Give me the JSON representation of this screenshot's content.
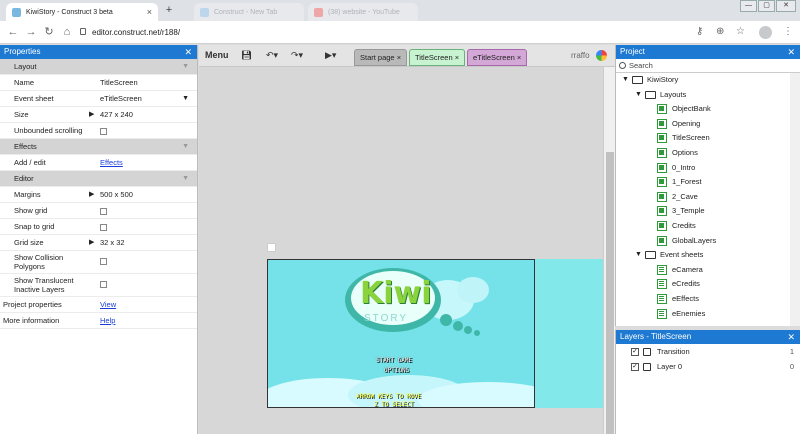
{
  "browser": {
    "tabs": [
      {
        "title": "KiwiStory - Construct 3 beta",
        "active": true
      },
      {
        "title": "Construct - New Tab",
        "active": false
      },
      {
        "title": "(38) website - YouTube",
        "active": false
      }
    ],
    "url": "editor.construct.net/r188/",
    "new_tab": "+",
    "win_min": "—",
    "win_max": "▢",
    "win_close": "✕"
  },
  "properties": {
    "title": "Properties",
    "close": "✕",
    "layout_section": "Layout",
    "rows_layout": [
      {
        "label": "Name",
        "value": "TitleScreen"
      },
      {
        "label": "Event sheet",
        "value": "eTitleScreen"
      },
      {
        "label": "Size",
        "value": "427 x 240"
      },
      {
        "label": "Unbounded scrolling",
        "value": ""
      }
    ],
    "effects_section": "Effects",
    "add_edit": {
      "label": "Add / edit",
      "value": "Effects"
    },
    "editor_section": "Editor",
    "rows_editor": [
      {
        "label": "Margins",
        "value": "500 x 500"
      },
      {
        "label": "Show grid",
        "value": ""
      },
      {
        "label": "Snap to grid",
        "value": ""
      },
      {
        "label": "Grid size",
        "value": "32 x 32"
      },
      {
        "label": "Show Collision Polygons",
        "value": ""
      },
      {
        "label": "Show Translucent Inactive Layers",
        "value": ""
      }
    ],
    "project_properties": {
      "label": "Project properties",
      "value": "View"
    },
    "more_info": {
      "label": "More information",
      "value": "Help"
    }
  },
  "toolbar": {
    "menu": "Menu",
    "tabs": [
      {
        "label": "Start page",
        "active": false
      },
      {
        "label": "TitleScreen",
        "active": true
      },
      {
        "label": "eTitleScreen",
        "active": false
      }
    ],
    "user": "rraffo"
  },
  "canvas": {
    "logo_main": "Kiwi",
    "logo_sub": "STORY",
    "menu_items": [
      "START GAME",
      "OPTIONS"
    ],
    "hint1": "ARROW KEYS TO MOVE",
    "hint2": "Z TO SELECT"
  },
  "project": {
    "title": "Project",
    "close": "✕",
    "search": "Search",
    "root": "KiwiStory",
    "layouts_folder": "Layouts",
    "layouts": [
      "ObjectBank",
      "Opening",
      "TitleScreen",
      "Options",
      "0_Intro",
      "1_Forest",
      "2_Cave",
      "3_Temple",
      "Credits",
      "GlobalLayers"
    ],
    "events_folder": "Event sheets",
    "event_sheets": [
      "eCamera",
      "eCredits",
      "eEffects",
      "eEnemies"
    ]
  },
  "layers": {
    "title": "Layers - TitleScreen",
    "close": "✕",
    "rows": [
      {
        "name": "Transition",
        "index": "1"
      },
      {
        "name": "Layer 0",
        "index": "0"
      }
    ]
  },
  "colors": {
    "accent": "#1e79d3",
    "active_tab": "#c8f3d0",
    "canvas": "#6ee0e6"
  }
}
